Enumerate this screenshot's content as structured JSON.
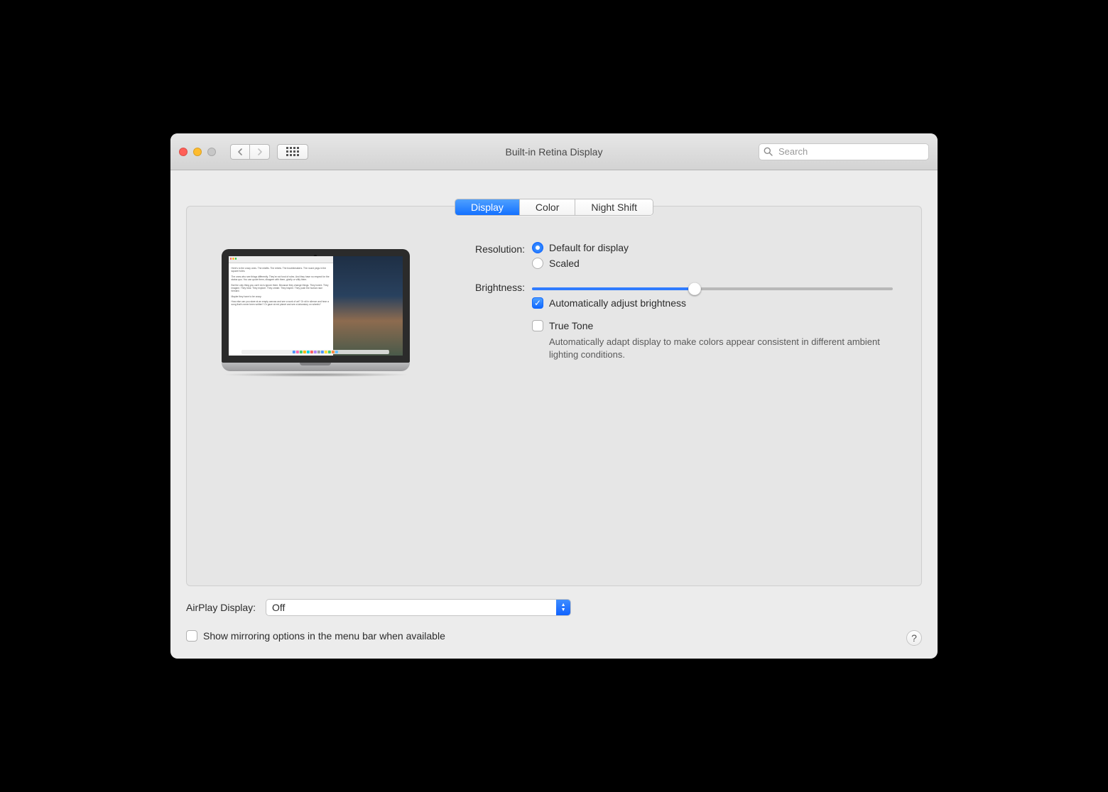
{
  "window": {
    "title": "Built-in Retina Display"
  },
  "search": {
    "placeholder": "Search"
  },
  "tabs": {
    "display": "Display",
    "color": "Color",
    "night_shift": "Night Shift"
  },
  "resolution": {
    "label": "Resolution:",
    "default": "Default for display",
    "scaled": "Scaled"
  },
  "brightness": {
    "label": "Brightness:",
    "value_percent": 45,
    "auto_label": "Automatically adjust brightness",
    "auto_checked": true,
    "truetone_label": "True Tone",
    "truetone_checked": false,
    "truetone_desc": "Automatically adapt display to make colors appear consistent in different ambient lighting conditions."
  },
  "airplay": {
    "label": "AirPlay Display:",
    "value": "Off"
  },
  "mirroring": {
    "label": "Show mirroring options in the menu bar when available",
    "checked": false
  },
  "help": "?"
}
